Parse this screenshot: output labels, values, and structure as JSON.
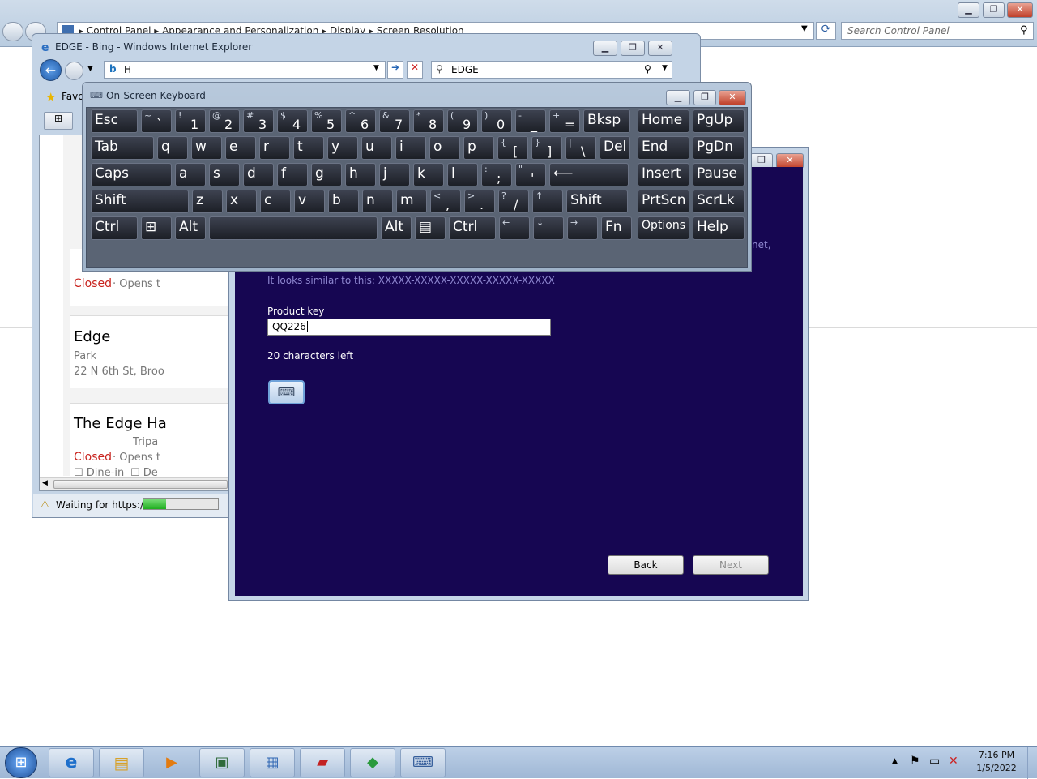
{
  "control_panel": {
    "breadcrumb": [
      "Control Panel",
      "Appearance and Personalization",
      "Display",
      "Screen Resolution"
    ],
    "search_placeholder": "Search Control Panel"
  },
  "ie": {
    "title": "EDGE - Bing - Windows Internet Explorer",
    "address": "H",
    "search_value": "EDGE",
    "favorites_label": "Favo",
    "status": "Waiting for https://",
    "progress": 0.3,
    "results": [
      {
        "status": "Closed",
        "hours": "Opens t"
      },
      {
        "name": "Edge",
        "category": "Park",
        "address": "22 N 6th St, Broo"
      },
      {
        "name": "The Edge Ha",
        "source": "Tripa",
        "status": "Closed",
        "hours": "Opens t",
        "options": [
          "Dine-in",
          "De"
        ]
      }
    ]
  },
  "osk": {
    "title": "On-Screen Keyboard",
    "rows": [
      [
        {
          "m": "Esc"
        },
        {
          "s": "~",
          "b": "`"
        },
        {
          "s": "!",
          "b": "1"
        },
        {
          "s": "@",
          "b": "2"
        },
        {
          "s": "#",
          "b": "3"
        },
        {
          "s": "$",
          "b": "4"
        },
        {
          "s": "%",
          "b": "5"
        },
        {
          "s": "^",
          "b": "6"
        },
        {
          "s": "&",
          "b": "7"
        },
        {
          "s": "*",
          "b": "8"
        },
        {
          "s": "(",
          "b": "9"
        },
        {
          "s": ")",
          "b": "0"
        },
        {
          "s": "-",
          "b": "_"
        },
        {
          "s": "+",
          "b": "="
        },
        {
          "m": "Bksp"
        }
      ],
      [
        {
          "m": "Tab"
        },
        {
          "m": "q"
        },
        {
          "m": "w"
        },
        {
          "m": "e"
        },
        {
          "m": "r"
        },
        {
          "m": "t"
        },
        {
          "m": "y"
        },
        {
          "m": "u"
        },
        {
          "m": "i"
        },
        {
          "m": "o"
        },
        {
          "m": "p"
        },
        {
          "s": "{",
          "b": "["
        },
        {
          "s": "}",
          "b": "]"
        },
        {
          "s": "|",
          "b": "\\"
        },
        {
          "m": "Del"
        }
      ],
      [
        {
          "m": "Caps"
        },
        {
          "m": "a"
        },
        {
          "m": "s"
        },
        {
          "m": "d"
        },
        {
          "m": "f"
        },
        {
          "m": "g"
        },
        {
          "m": "h"
        },
        {
          "m": "j"
        },
        {
          "m": "k"
        },
        {
          "m": "l"
        },
        {
          "s": ":",
          "b": ";"
        },
        {
          "s": "\"",
          "b": "'"
        },
        {
          "m": "⟵"
        }
      ],
      [
        {
          "m": "Shift"
        },
        {
          "m": "z"
        },
        {
          "m": "x"
        },
        {
          "m": "c"
        },
        {
          "m": "v"
        },
        {
          "m": "b"
        },
        {
          "m": "n"
        },
        {
          "m": "m"
        },
        {
          "s": "<",
          "b": ","
        },
        {
          "s": ">",
          "b": "."
        },
        {
          "s": "?",
          "b": "/"
        },
        {
          "s": "↑",
          "b": ""
        },
        {
          "m": "Shift"
        }
      ],
      [
        {
          "m": "Ctrl"
        },
        {
          "m": "⊞"
        },
        {
          "m": "Alt"
        },
        {
          "m": ""
        },
        {
          "m": "Alt"
        },
        {
          "m": "▤"
        },
        {
          "m": "Ctrl"
        },
        {
          "s": "←",
          "b": ""
        },
        {
          "s": "↓",
          "b": ""
        },
        {
          "s": "→",
          "b": ""
        },
        {
          "m": "Fn"
        }
      ]
    ],
    "nav_keys": [
      [
        "Home",
        "PgUp"
      ],
      [
        "End",
        "PgDn"
      ],
      [
        "Insert",
        "Pause"
      ],
      [
        "PrtScn",
        "ScrLk"
      ],
      [
        "Options",
        "Help"
      ]
    ]
  },
  "wizard": {
    "partial_text": "net,",
    "example": "It looks similar to this: XXXXX-XXXXX-XXXXX-XXXXX-XXXXX",
    "product_key_label": "Product key",
    "product_key_value": "QQ226",
    "chars_left": "20 characters left",
    "back_label": "Back",
    "next_label": "Next"
  },
  "taskbar": {
    "time": "7:16 PM",
    "date": "1/5/2022",
    "colors": {
      "wizard_bg": "#160652",
      "progress": "#3cc43c"
    }
  }
}
